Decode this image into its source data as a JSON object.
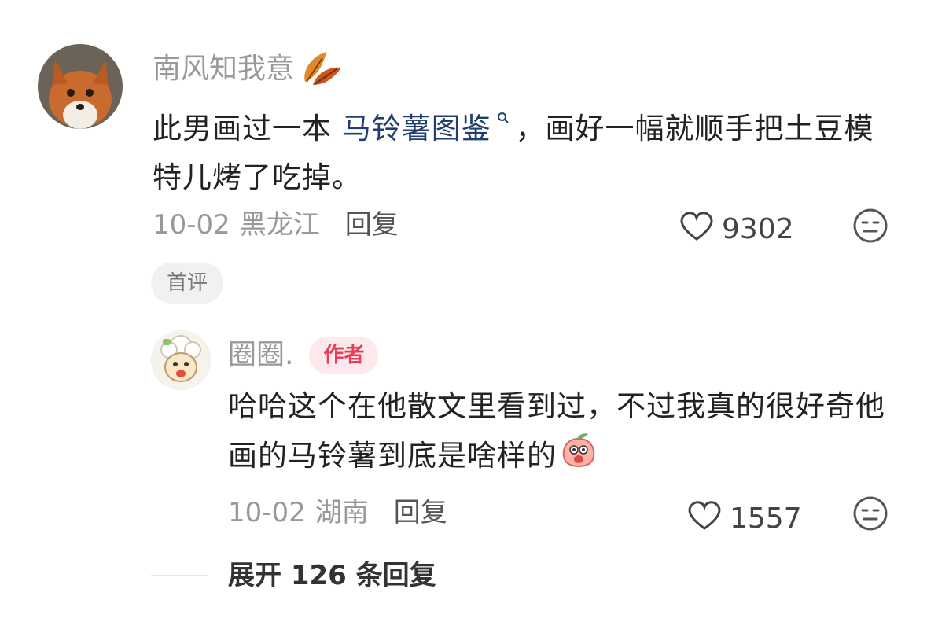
{
  "comment": {
    "username": "南风知我意",
    "content_prefix": "此男画过一本 ",
    "topic_link": "马铃薯图鉴",
    "content_suffix": "，画好一幅就顺手把土豆模特儿烤了吃掉。",
    "date": "10-02",
    "location": "黑龙江",
    "reply_label": "回复",
    "likes": "9302",
    "tag": "首评",
    "icons": [
      "leaf-icon",
      "heart-icon",
      "meh-face-icon"
    ]
  },
  "reply": {
    "username": "圈圈.",
    "badge": "作者",
    "content": "哈哈这个在他散文里看到过，不过我真的很好奇他画的马铃薯到底是啥样的",
    "date": "10-02",
    "location": "湖南",
    "reply_label": "回复",
    "likes": "1557",
    "icons": [
      "peach-emoji-icon",
      "heart-icon",
      "meh-face-icon"
    ]
  },
  "expand": {
    "label": "展开 126 条回复"
  },
  "colors": {
    "topic_link": "#1f3f6e",
    "author_badge_bg": "#fde9ec",
    "author_badge_text": "#ea3b57"
  }
}
